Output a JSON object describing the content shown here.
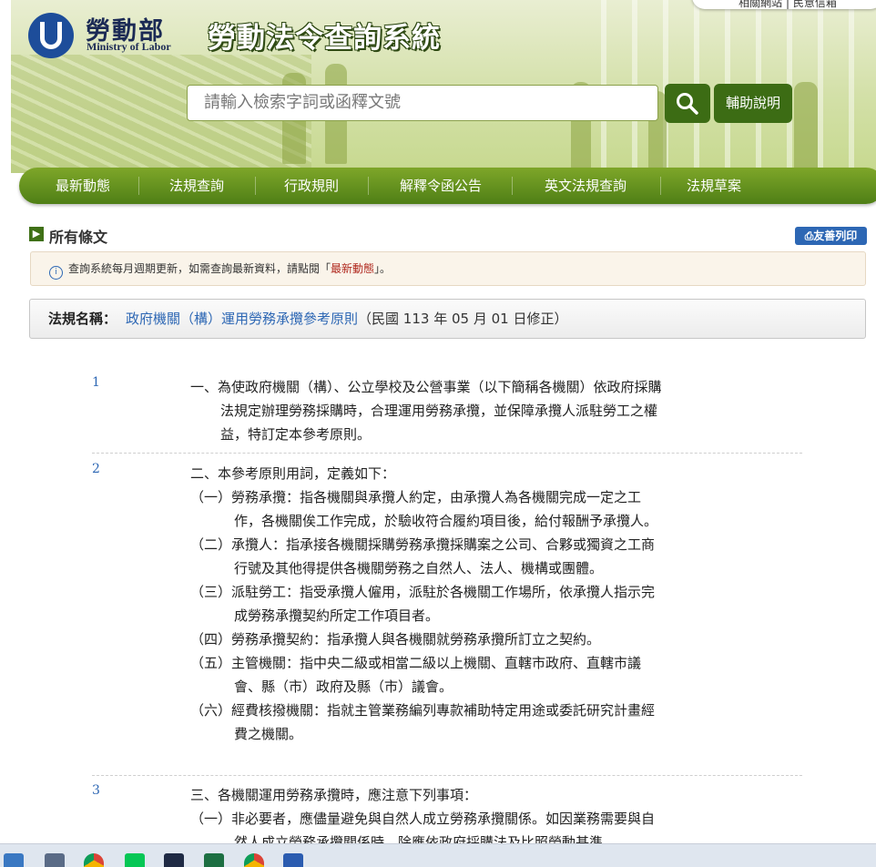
{
  "header": {
    "logo_zh": "勞動部",
    "logo_en": "Ministry of Labor",
    "system_title": "勞動法令查詢系統",
    "top_links": "相關網站 | 民意信箱",
    "search_placeholder": "請輸入檢索字詞或函釋文號",
    "help_label": "輔助說明"
  },
  "nav": [
    "最新動態",
    "法規查詢",
    "行政規則",
    "解釋令函公告",
    "英文法規查詢",
    "法規草案"
  ],
  "section": {
    "title": "所有條文",
    "print_label": "友善列印"
  },
  "notice": {
    "text_before": "查詢系統每月週期更新，如需查詢最新資料，請點閱「",
    "link_text": "最新動態",
    "text_after": "」。"
  },
  "law": {
    "label": "法規名稱：",
    "name": "政府機關（構）運用勞務承攬參考原則",
    "date": "（民國 113 年 05 月 01 日修正）"
  },
  "articles": [
    {
      "num": "1",
      "paragraphs": [
        "一、為使政府機關（構）、公立學校及公營事業（以下簡稱各機關）依政府採購法規定辦理勞務採購時，合理運用勞務承攬，並保障承攬人派駐勞工之權益，特訂定本參考原則。"
      ]
    },
    {
      "num": "2",
      "paragraphs": [
        "二、本參考原則用詞，定義如下：",
        "（一）勞務承攬：指各機關與承攬人約定，由承攬人為各機關完成一定之工作，各機關俟工作完成，於驗收符合履約項目後，給付報酬予承攬人。",
        "（二）承攬人：指承接各機關採購勞務承攬採購案之公司、合夥或獨資之工商行號及其他得提供各機關勞務之自然人、法人、機構或團體。",
        "（三）派駐勞工：指受承攬人僱用，派駐於各機關工作場所，依承攬人指示完成勞務承攬契約所定工作項目者。",
        "（四）勞務承攬契約：指承攬人與各機關就勞務承攬所訂立之契約。",
        "（五）主管機關：指中央二級或相當二級以上機關、直轄市政府、直轄市議會、縣（市）政府及縣（市）議會。",
        "（六）經費核撥機關：指就主管業務編列專款補助特定用途或委託研究計畫經費之機關。"
      ]
    },
    {
      "num": "3",
      "paragraphs": [
        "三、各機關運用勞務承攬時，應注意下列事項：",
        "（一）非必要者，應儘量避免與自然人成立勞務承攬關係。如因業務需要與自然人成立勞務承攬關係時，除應依政府採購法及比照勞動基準"
      ]
    }
  ],
  "taskbar_icons": [
    "file-manager-icon",
    "calendar-icon",
    "chrome-icon",
    "line-icon",
    "meet-icon",
    "excel-icon",
    "chrome-profile-icon",
    "word-icon"
  ]
}
